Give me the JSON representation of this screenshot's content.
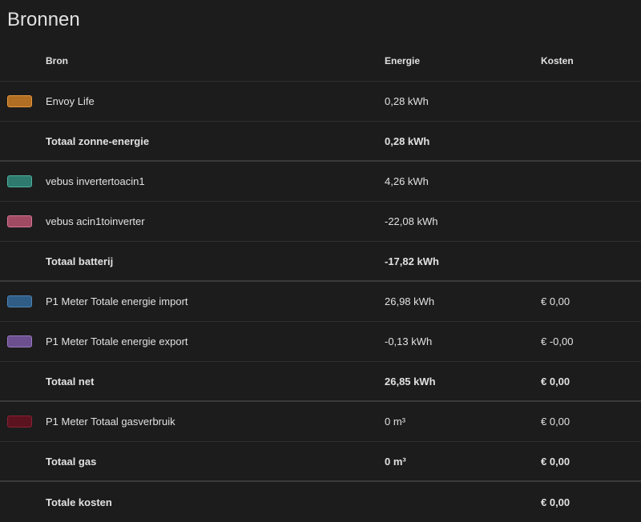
{
  "title": "Bronnen",
  "headers": {
    "source": "Bron",
    "energy": "Energie",
    "cost": "Kosten"
  },
  "rows": [
    {
      "name": "Envoy Life",
      "energy": "0,28 kWh",
      "cost": "",
      "fill": "#b06d24",
      "border": "#e89a3c"
    },
    {
      "name": "Totaal zonne-energie",
      "energy": "0,28 kWh",
      "cost": ""
    },
    {
      "name": "vebus invertertoacin1",
      "energy": "4,26 kWh",
      "cost": "",
      "fill": "#2e7a6e",
      "border": "#4fb3a3"
    },
    {
      "name": "vebus acin1toinverter",
      "energy": "-22,08 kWh",
      "cost": "",
      "fill": "#a04a64",
      "border": "#d9779a"
    },
    {
      "name": "Totaal batterij",
      "energy": "-17,82 kWh",
      "cost": ""
    },
    {
      "name": "P1 Meter Totale energie import",
      "energy": "26,98 kWh",
      "cost": "€ 0,00",
      "fill": "#2f5d85",
      "border": "#4f86b8"
    },
    {
      "name": "P1 Meter Totale energie export",
      "energy": "-0,13 kWh",
      "cost": "€ -0,00",
      "fill": "#6b4f8f",
      "border": "#9a7cc4"
    },
    {
      "name": "Totaal net",
      "energy": "26,85 kWh",
      "cost": "€ 0,00"
    },
    {
      "name": "P1 Meter Totaal gasverbruik",
      "energy": "0 m³",
      "cost": "€ 0,00",
      "fill": "#5c1320",
      "border": "#8a2234"
    },
    {
      "name": "Totaal gas",
      "energy": "0 m³",
      "cost": "€ 0,00"
    },
    {
      "name": "Totale kosten",
      "energy": "",
      "cost": "€ 0,00"
    }
  ]
}
